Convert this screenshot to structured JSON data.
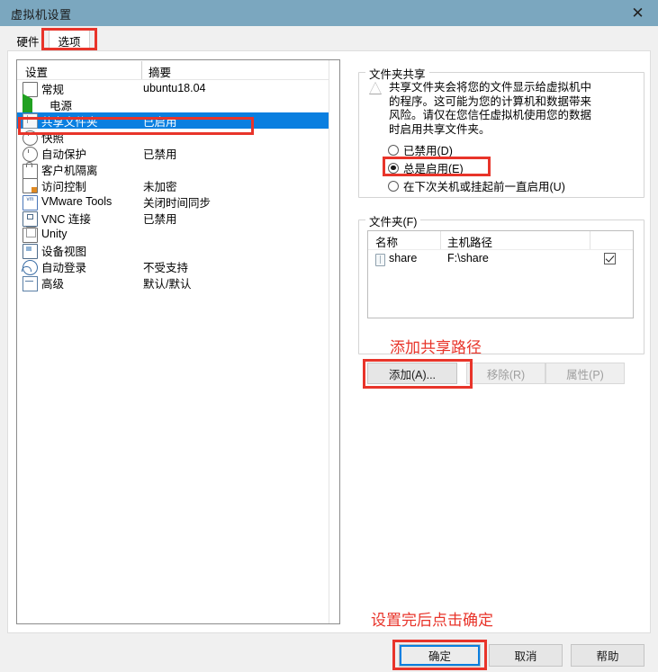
{
  "window": {
    "title": "虚拟机设置",
    "close_icon": "close-icon"
  },
  "tabs": [
    {
      "label": "硬件",
      "selected": false
    },
    {
      "label": "选项",
      "selected": true
    }
  ],
  "settings_list": {
    "columns": [
      "设置",
      "摘要"
    ],
    "rows": [
      {
        "icon": "monitor-icon",
        "name": "常规",
        "summary": "ubuntu18.04",
        "selected": false
      },
      {
        "icon": "power-icon",
        "name": "电源",
        "summary": "",
        "selected": false
      },
      {
        "icon": "folder-icon",
        "name": "共享文件夹",
        "summary": "已启用",
        "selected": true
      },
      {
        "icon": "snapshot-icon",
        "name": "快照",
        "summary": "",
        "selected": false
      },
      {
        "icon": "clock-icon",
        "name": "自动保护",
        "summary": "已禁用",
        "selected": false
      },
      {
        "icon": "lock-icon",
        "name": "客户机隔离",
        "summary": "",
        "selected": false
      },
      {
        "icon": "access-icon",
        "name": "访问控制",
        "summary": "未加密",
        "selected": false
      },
      {
        "icon": "vmtools-icon",
        "name": "VMware Tools",
        "summary": "关闭时间同步",
        "selected": false
      },
      {
        "icon": "vnc-icon",
        "name": "VNC 连接",
        "summary": "已禁用",
        "selected": false
      },
      {
        "icon": "unity-icon",
        "name": "Unity",
        "summary": "",
        "selected": false
      },
      {
        "icon": "device-icon",
        "name": "设备视图",
        "summary": "",
        "selected": false
      },
      {
        "icon": "user-icon",
        "name": "自动登录",
        "summary": "不受支持",
        "selected": false
      },
      {
        "icon": "advanced-icon",
        "name": "高级",
        "summary": "默认/默认",
        "selected": false
      }
    ]
  },
  "folder_sharing": {
    "legend": "文件夹共享",
    "warning_icon": "warning-triangle-icon",
    "warning_text": "共享文件夹会将您的文件显示给虚拟机中\n的程序。这可能为您的计算机和数据带来\n风险。请仅在您信任虚拟机使用您的数据\n时启用共享文件夹。",
    "options": [
      {
        "label": "已禁用(D)",
        "selected": false
      },
      {
        "label": "总是启用(E)",
        "selected": true
      },
      {
        "label": "在下次关机或挂起前一直启用(U)",
        "selected": false
      }
    ]
  },
  "folders": {
    "legend": "文件夹(F)",
    "columns": [
      "名称",
      "主机路径"
    ],
    "rows": [
      {
        "icon": "folder-icon",
        "name": "share",
        "host_path": "F:\\share",
        "enabled": true
      }
    ],
    "buttons": {
      "add": "添加(A)...",
      "remove": "移除(R)",
      "properties": "属性(P)"
    }
  },
  "dialog_buttons": {
    "ok": "确定",
    "cancel": "取消",
    "help": "帮助"
  },
  "annotations": {
    "add_share_path": "添加共享路径",
    "click_ok": "设置完后点击确定",
    "color": "#e8342a"
  }
}
